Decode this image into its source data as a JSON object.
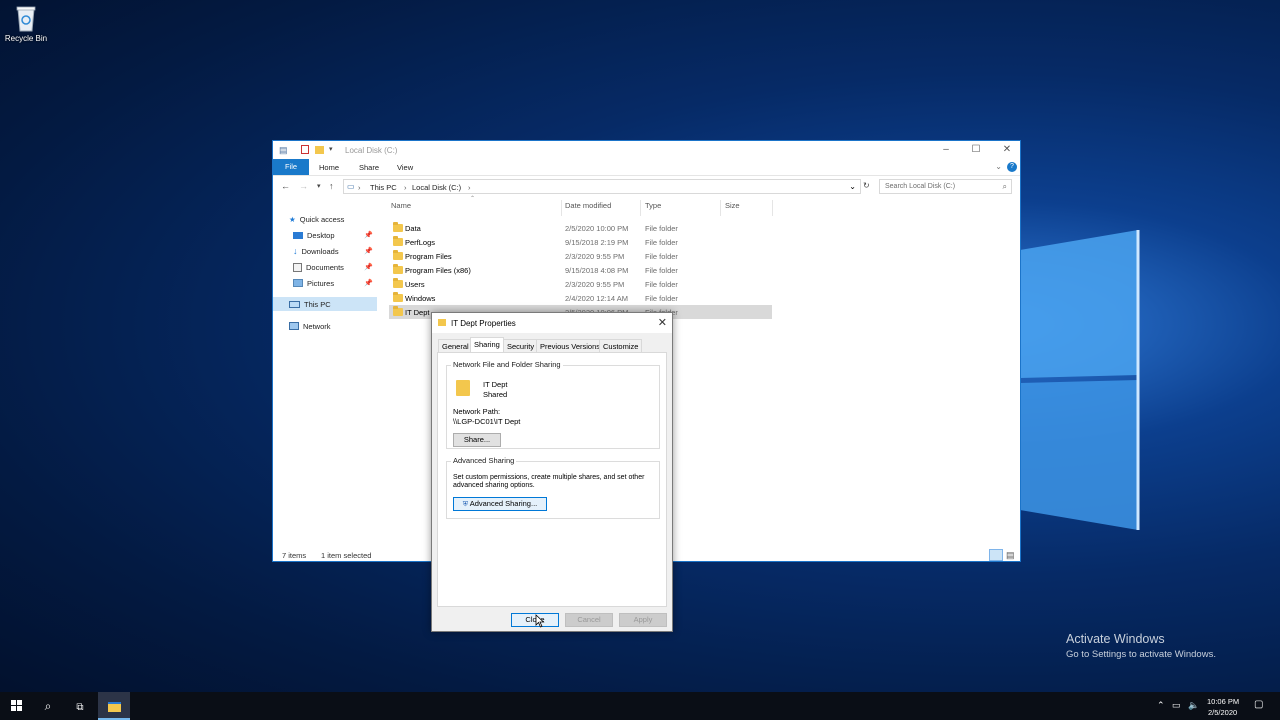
{
  "desktop": {
    "recycle_bin_label": "Recycle Bin",
    "watermark_title": "Activate Windows",
    "watermark_sub": "Go to Settings to activate Windows."
  },
  "explorer": {
    "title": "Local Disk (C:)",
    "ribbon_tabs": [
      "File",
      "Home",
      "Share",
      "View"
    ],
    "breadcrumb": [
      "This PC",
      "Local Disk (C:)"
    ],
    "search_placeholder": "Search Local Disk (C:)",
    "nav": {
      "quick_access": "Quick access",
      "desktop": "Desktop",
      "downloads": "Downloads",
      "documents": "Documents",
      "pictures": "Pictures",
      "this_pc": "This PC",
      "network": "Network"
    },
    "columns": [
      "Name",
      "Date modified",
      "Type",
      "Size"
    ],
    "rows": [
      {
        "name": "Data",
        "date": "2/5/2020 10:00 PM",
        "type": "File folder"
      },
      {
        "name": "PerfLogs",
        "date": "9/15/2018 2:19 PM",
        "type": "File folder"
      },
      {
        "name": "Program Files",
        "date": "2/3/2020 9:55 PM",
        "type": "File folder"
      },
      {
        "name": "Program Files (x86)",
        "date": "9/15/2018 4:08 PM",
        "type": "File folder"
      },
      {
        "name": "Users",
        "date": "2/3/2020 9:55 PM",
        "type": "File folder"
      },
      {
        "name": "Windows",
        "date": "2/4/2020 12:14 AM",
        "type": "File folder"
      },
      {
        "name": "IT Dept",
        "date": "2/5/2020 10:06 PM",
        "type": "File folder"
      }
    ],
    "status_items": "7 items",
    "status_selected": "1 item selected"
  },
  "dialog": {
    "title": "IT Dept Properties",
    "tabs": [
      "General",
      "Sharing",
      "Security",
      "Previous Versions",
      "Customize"
    ],
    "sharing_group_title": "Network File and Folder Sharing",
    "folder_name": "IT Dept",
    "folder_state": "Shared",
    "network_path_label": "Network Path:",
    "network_path": "\\\\LGP-DC01\\IT Dept",
    "share_button": "Share...",
    "advanced_group_title": "Advanced Sharing",
    "advanced_desc_1": "Set custom permissions, create multiple shares, and set other",
    "advanced_desc_2": "advanced sharing options.",
    "advanced_button": "Advanced Sharing...",
    "close_button": "Close",
    "cancel_button": "Cancel",
    "apply_button": "Apply"
  },
  "taskbar": {
    "time": "10:06 PM",
    "date": "2/5/2020"
  }
}
